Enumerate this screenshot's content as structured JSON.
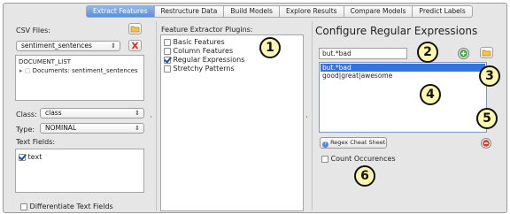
{
  "tabs": [
    "Extract Features",
    "Restructure Data",
    "Build Models",
    "Explore Results",
    "Compare Models",
    "Predict Labels"
  ],
  "left": {
    "csv_label": "CSV Files:",
    "csv_selected": "sentiment_sentences",
    "tree_root": "DOCUMENT_LIST",
    "tree_child": "Documents: sentiment_sentences",
    "class_label": "Class:",
    "class_value": "class",
    "type_label": "Type:",
    "type_value": "NOMINAL",
    "text_fields_label": "Text Fields:",
    "text_field_item": "text",
    "differentiate_label": "Differentiate Text Fields"
  },
  "middle": {
    "plugins_label": "Feature Extractor Plugins:",
    "plugins": [
      {
        "label": "Basic Features",
        "checked": false
      },
      {
        "label": "Column Features",
        "checked": false
      },
      {
        "label": "Regular Expressions",
        "checked": true
      },
      {
        "label": "Stretchy Patterns",
        "checked": false
      }
    ]
  },
  "right": {
    "title": "Configure Regular Expressions",
    "regex_input_value": "but.*bad",
    "expressions": [
      "but.*bad",
      "good|great|awesome"
    ],
    "cheat_sheet_label": "Regex Cheat Sheet",
    "count_label": "Count Occurences"
  },
  "badges": [
    "1",
    "2",
    "3",
    "4",
    "5",
    "6"
  ],
  "colors": {
    "selection": "#3574dd",
    "add_green": "#3aa63a",
    "remove_red": "#d63b32",
    "badge_fill": "#fff8b0"
  }
}
